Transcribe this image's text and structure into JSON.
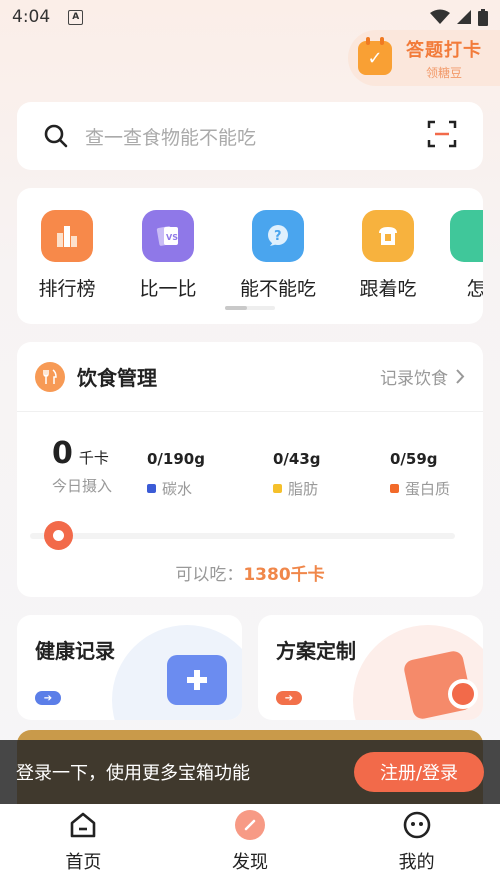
{
  "status": {
    "time": "4:04"
  },
  "checkin": {
    "title": "答题打卡",
    "sub": "领糖豆"
  },
  "search": {
    "placeholder": "查一查食物能不能吃"
  },
  "categories": [
    {
      "label": "排行榜",
      "color": "#f7894a"
    },
    {
      "label": "比一比",
      "color": "#8f78e8"
    },
    {
      "label": "能不能吃",
      "color": "#4aa5ee"
    },
    {
      "label": "跟着吃",
      "color": "#f7b23e"
    },
    {
      "label": "怎",
      "color": "#40c79a"
    }
  ],
  "diet": {
    "title": "饮食管理",
    "link": "记录饮食",
    "kcal_value": "0",
    "kcal_unit": "千卡",
    "kcal_sub": "今日摄入",
    "carb_value": "0/190g",
    "carb_label": "碳水",
    "fat_value": "0/43g",
    "fat_label": "脂肪",
    "protein_value": "0/59g",
    "protein_label": "蛋白质",
    "can_eat_label": "可以吃：",
    "can_eat_value": "1380千卡",
    "progress": 0,
    "colors": {
      "carb": "#3b5bd6",
      "fat": "#f5c02b",
      "protein": "#f26a2a"
    }
  },
  "cards": {
    "health": "健康记录",
    "plan": "方案定制"
  },
  "toast": {
    "text": "登录一下，使用更多宝箱功能",
    "button": "注册/登录"
  },
  "tabs": [
    {
      "label": "首页"
    },
    {
      "label": "发现"
    },
    {
      "label": "我的"
    }
  ],
  "accent": "#f26a4a"
}
